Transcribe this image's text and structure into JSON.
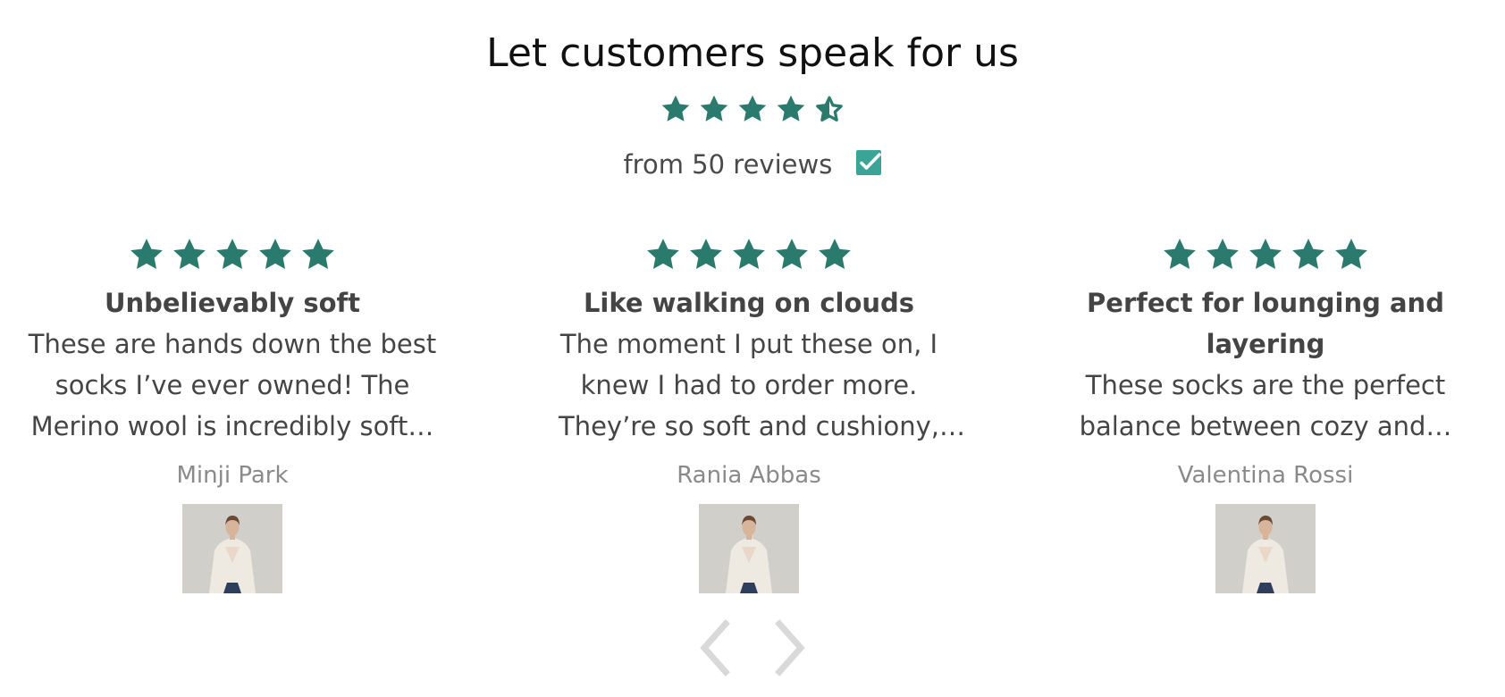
{
  "header": {
    "title": "Let customers speak for us",
    "rating": 4.5,
    "count_text": "from 50 reviews",
    "verified_icon": "verified-check-icon"
  },
  "colors": {
    "star": "#2a7a6e",
    "verified": "#3aa596",
    "arrow": "#d9d9d9"
  },
  "reviews": [
    {
      "stars": 5,
      "title": "Unbelievably soft",
      "body": "These are hands down the best socks I’ve ever owned! The Merino wool is incredibly soft…",
      "author": "Minji Park",
      "photo": "review-photo"
    },
    {
      "stars": 5,
      "title": "Like walking on clouds",
      "body": "The moment I put these on, I knew I had to order more. They’re so soft and cushiony, y…",
      "author": "Rania Abbas",
      "photo": "review-photo"
    },
    {
      "stars": 5,
      "title": "Perfect for lounging and layering",
      "body": "These socks are the perfect balance between cozy and…",
      "author": "Valentina Rossi",
      "photo": "review-photo"
    }
  ],
  "navigation": {
    "prev_icon": "chevron-left-icon",
    "next_icon": "chevron-right-icon"
  }
}
